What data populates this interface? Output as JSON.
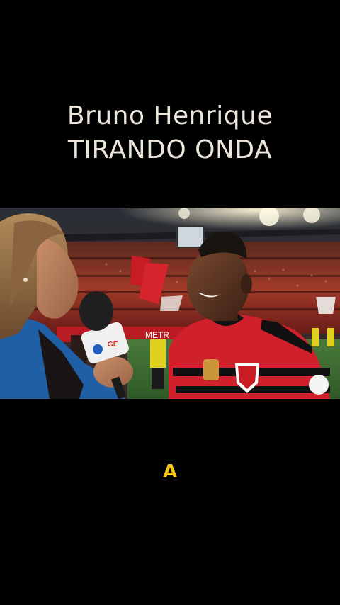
{
  "title": {
    "line1": "Bruno Henrique",
    "line2": "TIRANDO ONDA"
  },
  "video": {
    "microphone_label": "GE",
    "scoreboard_text": "METR",
    "colors": {
      "background": "#000000",
      "title_text": "#ece6dc",
      "caption_text": "#f5c518",
      "jersey_red": "#d0202c",
      "jacket_blue": "#1f5fa6"
    }
  },
  "caption": {
    "text": "A"
  }
}
